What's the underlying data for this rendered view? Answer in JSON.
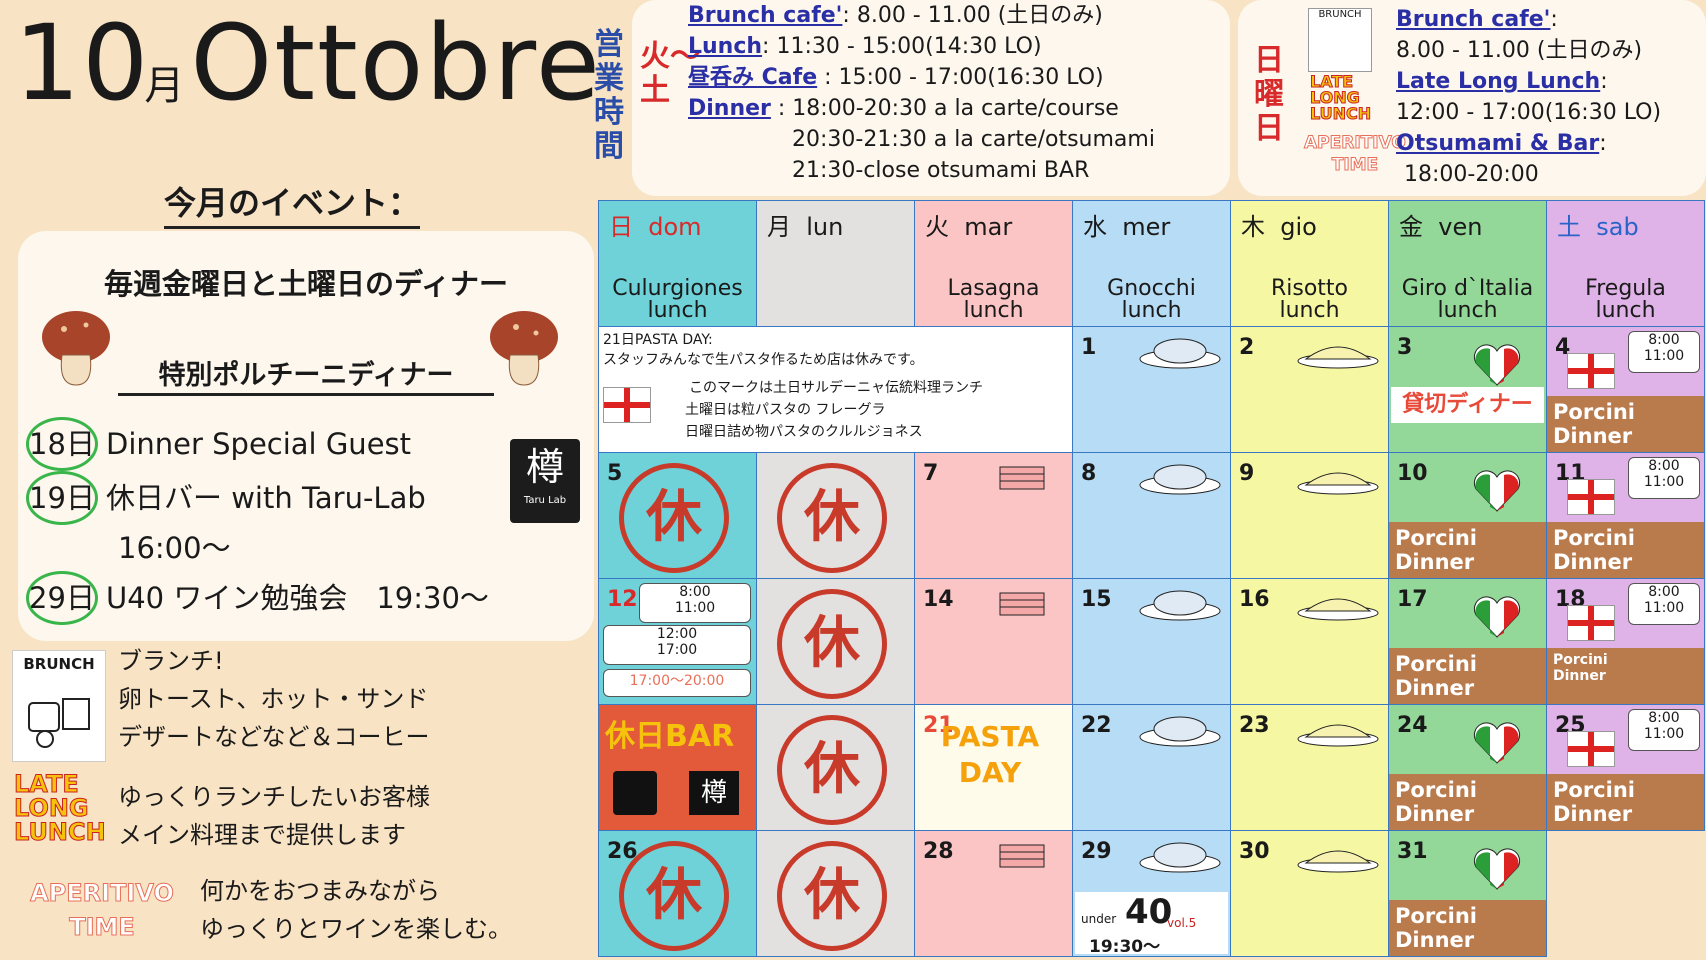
{
  "header": {
    "num": "10",
    "kanji": "月",
    "word": "Ottobre"
  },
  "events": {
    "title": "今月のイベント：",
    "weekly": "毎週金曜日と土曜日のディナー",
    "special": "特別ポルチーニディナー",
    "items": [
      {
        "day": "18日",
        "text": "Dinner Special Guest"
      },
      {
        "day": "19日",
        "text": "休日バー with Taru-Lab"
      },
      {
        "day": "",
        "text": "16:00～"
      },
      {
        "day": "29日",
        "text": "U40 ワイン勉強会　19:30～"
      }
    ],
    "taru_logo": "樽",
    "taru_name": "Taru Lab"
  },
  "legend": {
    "brunch_logo": "BRUNCH",
    "brunch_lines": [
      "ブランチ!",
      "卵トースト、ホット・サンド",
      "デザートなどなど＆コーヒー"
    ],
    "late_logo": [
      "LATE",
      "LONG",
      "LUNCH"
    ],
    "late_lines": [
      "ゆっくりランチしたいお客様",
      "メイン料理まで提供します"
    ],
    "aper_logo": [
      "APERITIVO",
      "TIME"
    ],
    "aper_lines": [
      "何かをおつまみながら",
      "ゆっくりとワインを楽しむ。"
    ]
  },
  "hours": {
    "label": "営業時間",
    "weekday_tag": "火〜土",
    "weekday": [
      {
        "k": "Brunch cafe'",
        "v": ": 8.00 - 11.00 (土日のみ)"
      },
      {
        "k": "Lunch",
        "v": ": 11:30 - 15:00(14:30 LO)"
      },
      {
        "k": "昼呑み Cafe",
        "v": " : 15:00 - 17:00(16:30 LO)"
      },
      {
        "k": "Dinner",
        "v": " : 18:00-20:30 a la carte/course"
      },
      {
        "k": "",
        "v": "20:30-21:30 a la carte/otsumami"
      },
      {
        "k": "",
        "v": "21:30-close otsumami BAR"
      }
    ],
    "sunday_tag": "日曜日",
    "sunday": [
      {
        "k": "Brunch cafe'",
        "v": ":"
      },
      {
        "k": "",
        "v": "8.00 - 11.00 (土日のみ)"
      },
      {
        "k": "Late Long Lunch",
        "v": ":"
      },
      {
        "k": "",
        "v": "12:00 - 17:00(16:30 LO)"
      },
      {
        "k": "Otsumami & Bar",
        "v": ":"
      },
      {
        "k": "",
        "v": "18:00-20:00"
      }
    ]
  },
  "calendar": {
    "days": [
      {
        "jp": "日",
        "it": "dom",
        "dish": "Culurgiones",
        "meal": "lunch"
      },
      {
        "jp": "月",
        "it": "lun",
        "dish": "",
        "meal": ""
      },
      {
        "jp": "火",
        "it": "mar",
        "dish": "Lasagna",
        "meal": "lunch"
      },
      {
        "jp": "水",
        "it": "mer",
        "dish": "Gnocchi",
        "meal": "lunch"
      },
      {
        "jp": "木",
        "it": "gio",
        "dish": "Risotto",
        "meal": "lunch"
      },
      {
        "jp": "金",
        "it": "ven",
        "dish": "Giro d`Italia",
        "meal": "lunch"
      },
      {
        "jp": "土",
        "it": "sab",
        "dish": "Fregula",
        "meal": "lunch"
      }
    ],
    "notes": {
      "pasta_day": "21日PASTA DAY:",
      "pasta_day_2": "スタッフみんなで生パスタ作るため店は休みです。",
      "mark_1": "このマークは土日サルデーニャ伝統料理ランチ",
      "mark_2": "土曜日は粒パスタの フレーグラ",
      "mark_3": "日曜日詰め物パスタのクルルジョネス"
    },
    "kyu": "休",
    "porcini": [
      "Porcini",
      "Dinner"
    ],
    "kashikiri": "貸切ディナー",
    "brunch_time": [
      "8:00",
      "11:00"
    ],
    "late_time": [
      "12:00",
      "17:00"
    ],
    "aper_time": "17:00～20:00",
    "kyujitsu_bar": "休日BAR",
    "pasta_day_label": [
      "PASTA",
      "DAY"
    ],
    "u40": {
      "under": "under",
      "num": "40",
      "vol": "vol.5",
      "time": "19:30～"
    },
    "nums": [
      "1",
      "2",
      "3",
      "4",
      "5",
      "7",
      "8",
      "9",
      "10",
      "11",
      "12",
      "14",
      "15",
      "16",
      "17",
      "18",
      "21",
      "22",
      "23",
      "24",
      "25",
      "26",
      "28",
      "29",
      "30",
      "31"
    ]
  }
}
